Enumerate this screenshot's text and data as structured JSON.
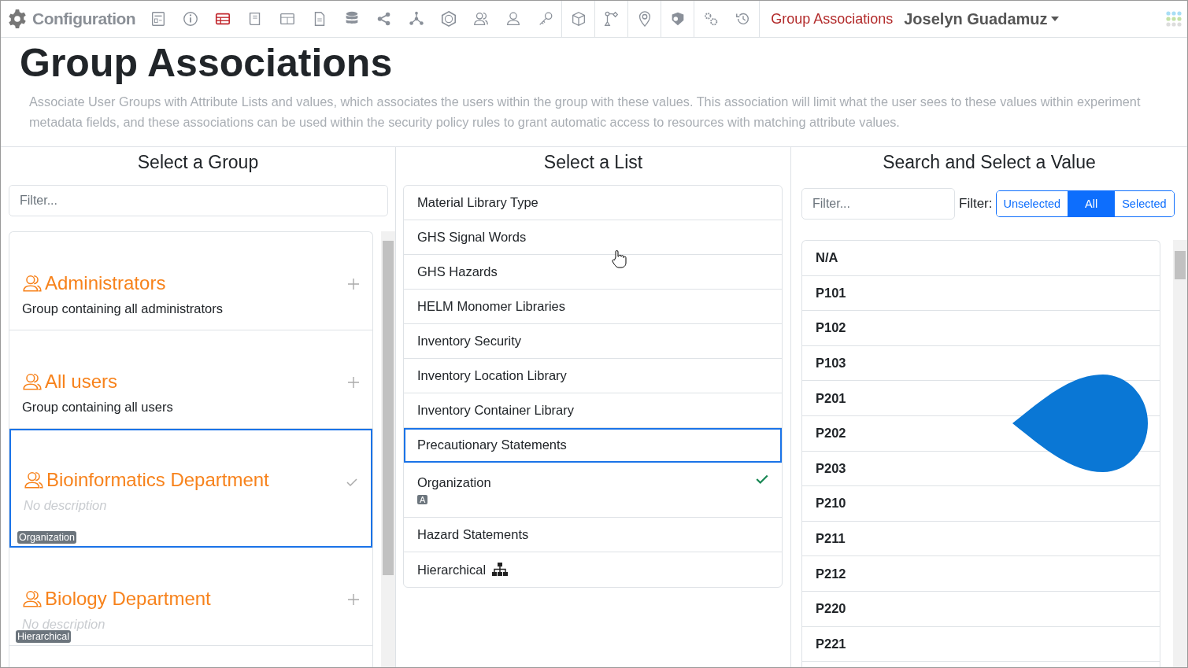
{
  "toolbar": {
    "brand": "Configuration",
    "icons": [
      {
        "selected": false
      },
      {
        "selected": false
      },
      {
        "selected": true
      },
      {
        "selected": false
      },
      {
        "selected": false
      },
      {
        "selected": false
      },
      {
        "selected": false
      },
      {
        "selected": false
      },
      {
        "selected": false
      },
      {
        "selected": false
      },
      {
        "selected": false
      },
      {
        "selected": false
      },
      {
        "selected": false
      },
      {
        "selected": false
      },
      {
        "selected": false
      },
      {
        "selected": false
      },
      {
        "selected": false
      },
      {
        "selected": false
      },
      {
        "selected": false
      }
    ],
    "page_link": "Group Associations",
    "user": "Joselyn Guadamuz"
  },
  "page": {
    "title": "Group Associations",
    "description": "Associate User Groups with Attribute Lists and values, which associates the users within the group with these values. This association will limit what the user sees to these values within experiment metadata fields, and these associations can be used within the security policy rules to grant automatic access to resources with matching attribute values."
  },
  "groups_panel": {
    "heading": "Select a Group",
    "filter_placeholder": "Filter...",
    "groups": [
      {
        "name": "Administrators",
        "description": "Group containing all administrators",
        "no_description": false,
        "selected": false
      },
      {
        "name": "All users",
        "description": "Group containing all users",
        "no_description": false,
        "selected": false
      },
      {
        "name": "Bioinformatics Department",
        "description": "No description",
        "no_description": true,
        "badge": "Organization",
        "selected": true
      },
      {
        "name": "Biology Department",
        "description": "No description",
        "no_description": true,
        "badge": "Hierarchical",
        "selected": false
      }
    ]
  },
  "lists_panel": {
    "heading": "Select a List",
    "lists": [
      {
        "name": "Material Library Type",
        "selected": false,
        "checked": false,
        "hierarchical": false
      },
      {
        "name": "GHS Signal Words",
        "selected": false,
        "checked": false,
        "hierarchical": false
      },
      {
        "name": "GHS Hazards",
        "selected": false,
        "checked": false,
        "hierarchical": false
      },
      {
        "name": "HELM Monomer Libraries",
        "selected": false,
        "checked": false,
        "hierarchical": false
      },
      {
        "name": "Inventory Security",
        "selected": false,
        "checked": false,
        "hierarchical": false
      },
      {
        "name": "Inventory Location Library",
        "selected": false,
        "checked": false,
        "hierarchical": false
      },
      {
        "name": "Inventory Container Library",
        "selected": false,
        "checked": false,
        "hierarchical": false
      },
      {
        "name": "Precautionary Statements",
        "selected": true,
        "checked": false,
        "hierarchical": false
      },
      {
        "name": "Organization",
        "selected": false,
        "checked": true,
        "hierarchical": false,
        "badge": "A"
      },
      {
        "name": "Hazard Statements",
        "selected": false,
        "checked": false,
        "hierarchical": false
      },
      {
        "name": "Hierarchical",
        "selected": false,
        "checked": false,
        "hierarchical": true
      }
    ]
  },
  "values_panel": {
    "heading": "Search and Select a Value",
    "filter_placeholder": "Filter...",
    "filter_label": "Filter:",
    "filter_options": [
      {
        "label": "Unselected",
        "selected": false
      },
      {
        "label": "All",
        "selected": true
      },
      {
        "label": "Selected",
        "selected": false
      }
    ],
    "values": [
      "N/A",
      "P101",
      "P102",
      "P103",
      "P201",
      "P202",
      "P203",
      "P210",
      "P211",
      "P212",
      "P220",
      "P221"
    ]
  }
}
